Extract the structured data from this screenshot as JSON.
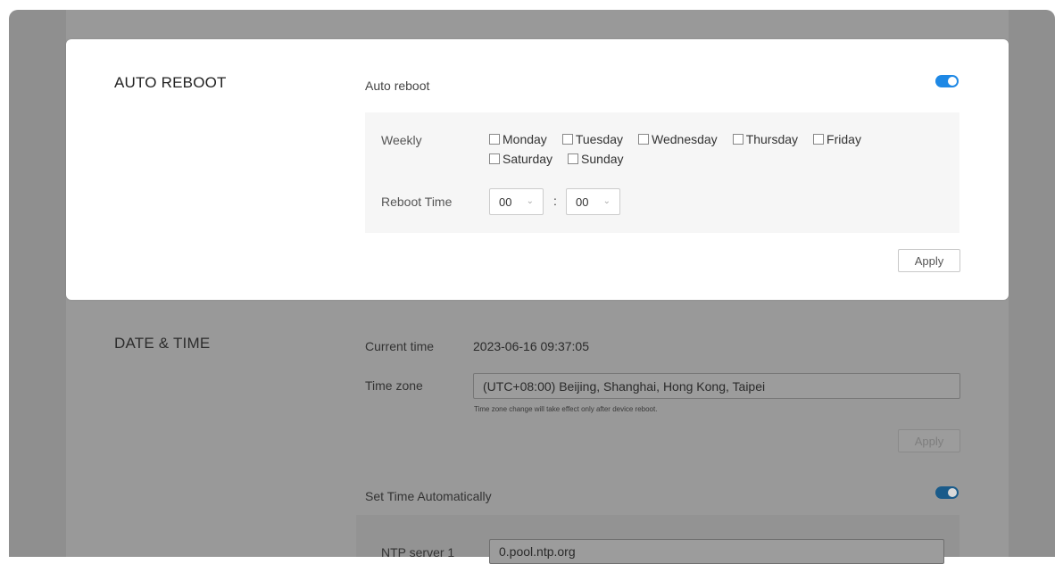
{
  "auto_reboot": {
    "section_title": "AUTO REBOOT",
    "toggle_label": "Auto reboot",
    "toggle_on": true,
    "weekly_label": "Weekly",
    "days": [
      "Monday",
      "Tuesday",
      "Wednesday",
      "Thursday",
      "Friday",
      "Saturday",
      "Sunday"
    ],
    "reboot_time_label": "Reboot Time",
    "hour": "00",
    "minute": "00",
    "separator": ":",
    "apply_label": "Apply"
  },
  "date_time": {
    "section_title": "DATE & TIME",
    "current_time_label": "Current time",
    "current_time_value": "2023-06-16 09:37:05",
    "time_zone_label": "Time zone",
    "time_zone_value": "(UTC+08:00) Beijing, Shanghai, Hong Kong, Taipei",
    "time_zone_hint": "Time zone change will take effect only after device reboot.",
    "apply_label": "Apply",
    "set_auto_label": "Set Time Automatically",
    "set_auto_on": true,
    "ntp1_label": "NTP server 1",
    "ntp1_value": "0.pool.ntp.org"
  },
  "colors": {
    "accent": "#1e88e5",
    "overlay": "#8f8f8f"
  }
}
